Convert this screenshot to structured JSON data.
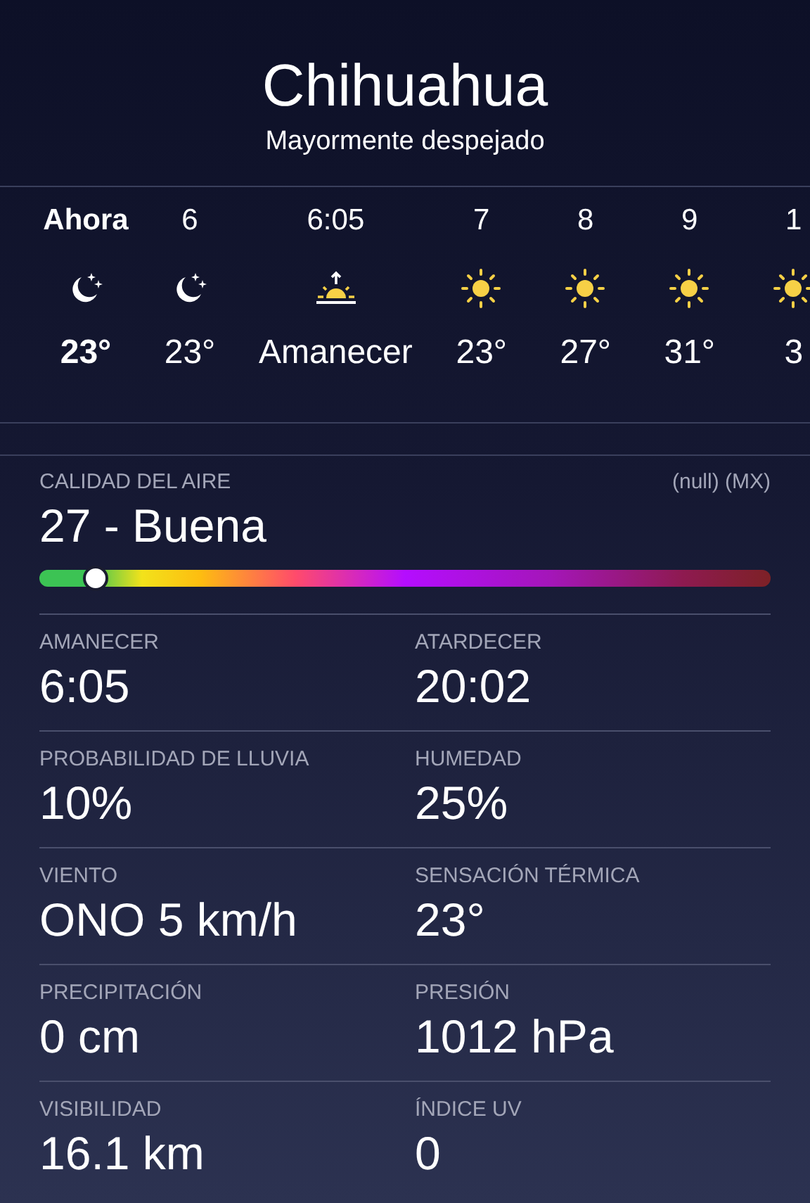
{
  "location": {
    "city": "Chihuahua",
    "condition": "Mayormente despejado"
  },
  "hourly": [
    {
      "time": "Ahora",
      "kind": "moon",
      "temp": "23°",
      "now": true
    },
    {
      "time": "6",
      "kind": "moon",
      "temp": "23°",
      "now": false
    },
    {
      "time": "6:05",
      "kind": "sunrise",
      "temp": "Amanecer",
      "now": false
    },
    {
      "time": "7",
      "kind": "sun",
      "temp": "23°",
      "now": false
    },
    {
      "time": "8",
      "kind": "sun",
      "temp": "27°",
      "now": false
    },
    {
      "time": "9",
      "kind": "sun",
      "temp": "31°",
      "now": false
    },
    {
      "time": "1",
      "kind": "sun",
      "temp": "3",
      "now": false
    }
  ],
  "air_quality": {
    "label": "CALIDAD DEL AIRE",
    "source": "(null) (MX)",
    "value": "27 - Buena",
    "level": 0.077
  },
  "details": [
    {
      "label": "AMANECER",
      "value": "6:05"
    },
    {
      "label": "ATARDECER",
      "value": "20:02"
    },
    {
      "label": "PROBABILIDAD DE LLUVIA",
      "value": "10%"
    },
    {
      "label": "HUMEDAD",
      "value": "25%"
    },
    {
      "label": "VIENTO",
      "value": "ONO 5 km/h"
    },
    {
      "label": "SENSACIÓN TÉRMICA",
      "value": "23°"
    },
    {
      "label": "PRECIPITACIÓN",
      "value": "0 cm"
    },
    {
      "label": "PRESIÓN",
      "value": "1012 hPa"
    },
    {
      "label": "VISIBILIDAD",
      "value": "16.1 km"
    },
    {
      "label": "ÍNDICE UV",
      "value": "0"
    }
  ]
}
